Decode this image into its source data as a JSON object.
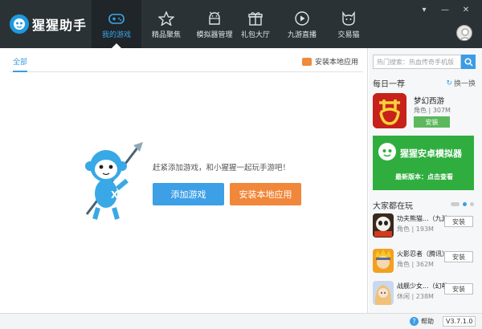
{
  "app": {
    "name": "猩猩助手"
  },
  "nav": [
    {
      "label": "我的游戏",
      "icon": "gamepad-icon"
    },
    {
      "label": "精品聚焦",
      "icon": "star-icon"
    },
    {
      "label": "模拟器管理",
      "icon": "android-icon"
    },
    {
      "label": "礼包大厅",
      "icon": "gift-icon"
    },
    {
      "label": "九游直播",
      "icon": "play-icon"
    },
    {
      "label": "交易猫",
      "icon": "cat-icon"
    }
  ],
  "window": {
    "menu": "▾",
    "minimize": "—",
    "close": "✕"
  },
  "tabs": {
    "all": "全部",
    "install_local": "安装本地应用"
  },
  "empty": {
    "message": "赶紧添加游戏，和小猩猩一起玩手游吧！",
    "add_button": "添加游戏",
    "install_button": "安装本地应用"
  },
  "sidebar": {
    "search_placeholder": "热门搜索：热血传奇手机版",
    "daily": {
      "title": "每日一荐",
      "refresh": "换一换",
      "game": {
        "name": "梦幻西游",
        "category": "角色",
        "size": "307M",
        "button": "安装"
      }
    },
    "banner": {
      "title": "猩猩安卓模拟器",
      "subtitle": "最新版本：点击查看"
    },
    "playing": {
      "title": "大家都在玩",
      "items": [
        {
          "name": "功夫熊猫...（九游",
          "category": "角色",
          "size": "193M",
          "button": "安装"
        },
        {
          "name": "火影忍者（腾讯）",
          "category": "角色",
          "size": "362M",
          "button": "安装"
        },
        {
          "name": "战舰少女...（幻萌",
          "category": "休闲",
          "size": "238M",
          "button": "安装"
        }
      ]
    }
  },
  "status": {
    "help": "帮助",
    "version": "V3.7.1.0"
  },
  "colors": {
    "topbar": "#2b3236",
    "accent": "#3c9ce5",
    "orange": "#f0873a",
    "green": "#2fae3f"
  }
}
